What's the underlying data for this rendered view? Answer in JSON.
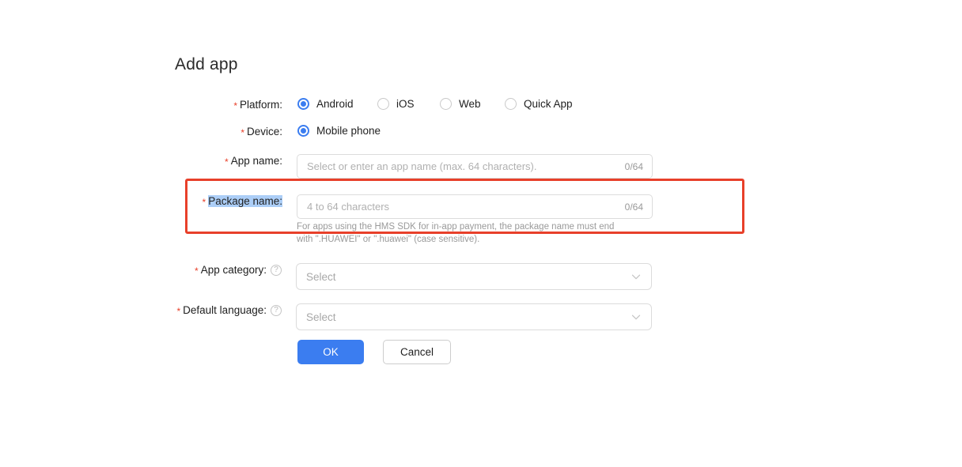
{
  "page": {
    "title": "Add app"
  },
  "form": {
    "platform": {
      "label": "Platform:",
      "required": true,
      "options": [
        {
          "label": "Android",
          "checked": true
        },
        {
          "label": "iOS",
          "checked": false
        },
        {
          "label": "Web",
          "checked": false
        },
        {
          "label": "Quick App",
          "checked": false
        }
      ]
    },
    "device": {
      "label": "Device:",
      "required": true,
      "options": [
        {
          "label": "Mobile phone",
          "checked": true
        }
      ]
    },
    "app_name": {
      "label": "App name:",
      "required": true,
      "placeholder": "Select or enter an app name (max. 64 characters).",
      "value": "",
      "counter": "0/64"
    },
    "package_name": {
      "label": "Package name:",
      "required": true,
      "selected": true,
      "placeholder": "4 to 64 characters",
      "value": "",
      "counter": "0/64",
      "hint": "For apps using the HMS SDK for in-app payment, the package name must end with \".HUAWEI\" or \".huawei\" (case sensitive)."
    },
    "app_category": {
      "label": "App category:",
      "required": true,
      "help": "?",
      "placeholder": "Select",
      "value": ""
    },
    "default_language": {
      "label": "Default language:",
      "required": true,
      "help": "?",
      "placeholder": "Select",
      "value": ""
    }
  },
  "actions": {
    "ok_label": "OK",
    "cancel_label": "Cancel"
  },
  "colors": {
    "accent_blue": "#3b7df0",
    "required_red": "#e8402a",
    "highlight_red": "#e8402a",
    "selection_blue": "#accef7"
  },
  "icons": {
    "chevron_down": "chevron-down-icon",
    "help": "help-circle-icon"
  }
}
